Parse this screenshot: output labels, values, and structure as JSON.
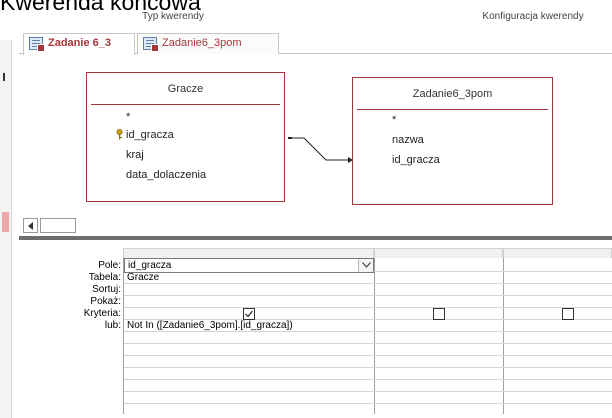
{
  "page": {
    "title": "Kwerenda końcowa"
  },
  "ribbon": {
    "group_left": "Typ kwerendy",
    "group_right": "Konfiguracja kwerendy"
  },
  "tabs": [
    {
      "label": "Zadanie 6_3",
      "active": true
    },
    {
      "label": "Zadanie6_3pom",
      "active": false
    }
  ],
  "tables": [
    {
      "title": "Gracze",
      "fields": [
        "*",
        "id_gracza",
        "kraj",
        "data_dolaczenia"
      ],
      "primary_key": "id_gracza"
    },
    {
      "title": "Zadanie6_3pom",
      "fields": [
        "*",
        "nazwa",
        "id_gracza"
      ]
    }
  ],
  "grid": {
    "row_labels": [
      "Pole:",
      "Tabela:",
      "Sortuj:",
      "Pokaż:",
      "Kryteria:",
      "lub:"
    ],
    "column1": {
      "field": "id_gracza",
      "table": "Gracze",
      "sort": "",
      "show": true,
      "criteria": "Not In ([Zadanie6_3pom].[id_gracza])",
      "or": ""
    },
    "column2": {
      "show": false
    },
    "column3": {
      "show": false
    }
  },
  "colors": {
    "accent": "#a4373a",
    "splitter": "#6d6d6d"
  }
}
